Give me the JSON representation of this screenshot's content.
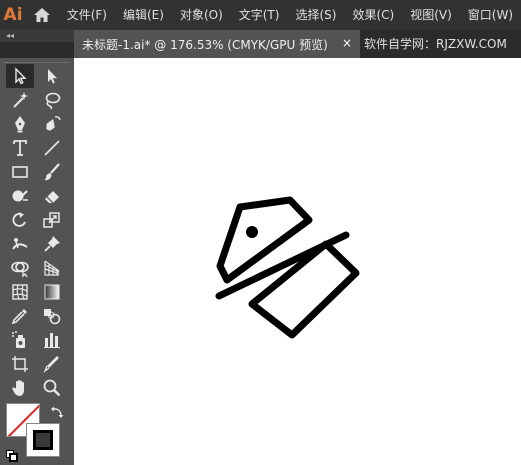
{
  "app": {
    "logo_text": "Ai",
    "accent_color": "#e07a3a"
  },
  "menu": {
    "items": [
      {
        "label": "文件(F)"
      },
      {
        "label": "编辑(E)"
      },
      {
        "label": "对象(O)"
      },
      {
        "label": "文字(T)"
      },
      {
        "label": "选择(S)"
      },
      {
        "label": "效果(C)"
      },
      {
        "label": "视图(V)"
      },
      {
        "label": "窗口(W)"
      }
    ]
  },
  "tabs": {
    "collapse_glyph": "◂◂",
    "document_title": "未标题-1.ai* @ 176.53% (CMYK/GPU 预览)",
    "close_glyph": "×",
    "watermark": "软件自学网：RJZXW.COM"
  },
  "toolbar": {
    "active_tool": "selection-tool",
    "tools": [
      "selection-tool",
      "direct-selection-tool",
      "magic-wand-tool",
      "lasso-tool",
      "pen-tool",
      "curvature-tool",
      "type-tool",
      "line-segment-tool",
      "rectangle-tool",
      "paintbrush-tool",
      "shaper-tool",
      "eraser-tool",
      "rotate-tool",
      "scale-tool",
      "puppet-warp-tool",
      "pin-tool",
      "shape-builder-tool",
      "perspective-grid-tool",
      "mesh-tool",
      "gradient-tool",
      "eyedropper-tool",
      "blend-tool",
      "symbol-sprayer-tool",
      "column-graph-tool",
      "artboard-tool",
      "slice-tool",
      "hand-tool",
      "zoom-tool"
    ]
  },
  "colors": {
    "fill": "none",
    "stroke": "#000000"
  }
}
